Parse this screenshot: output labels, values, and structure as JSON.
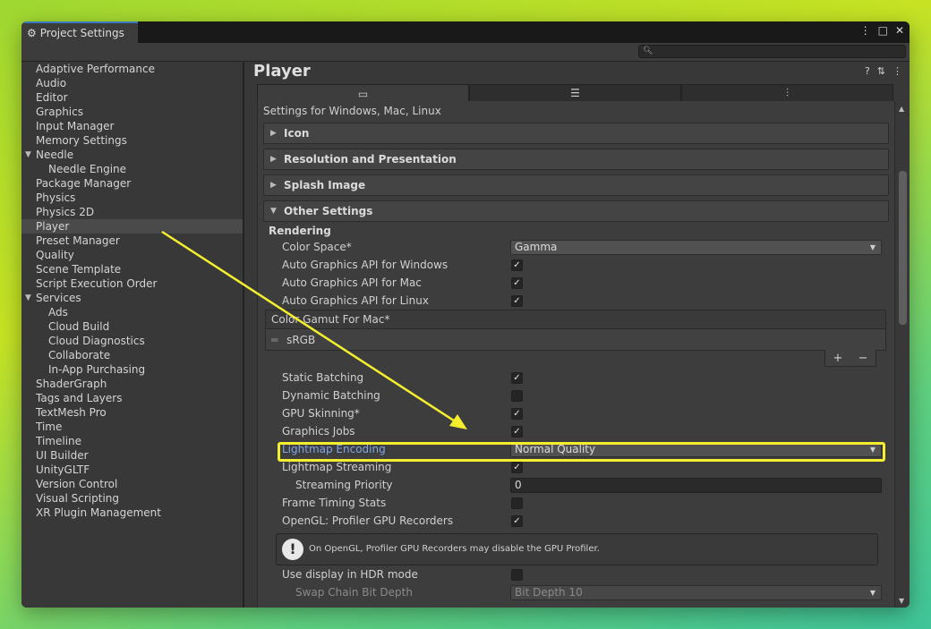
{
  "window": {
    "title": "Project Settings",
    "title_icon": "gear-icon",
    "controls": [
      "⋮",
      "□",
      "✕"
    ]
  },
  "search": {
    "placeholder": "",
    "icon": "search-icon"
  },
  "sidebar": {
    "items": [
      {
        "label": "Adaptive Performance"
      },
      {
        "label": "Audio"
      },
      {
        "label": "Editor"
      },
      {
        "label": "Graphics"
      },
      {
        "label": "Input Manager"
      },
      {
        "label": "Memory Settings"
      },
      {
        "label": "Needle"
      },
      {
        "label": "Needle Engine"
      },
      {
        "label": "Package Manager"
      },
      {
        "label": "Physics"
      },
      {
        "label": "Physics 2D"
      },
      {
        "label": "Player"
      },
      {
        "label": "Preset Manager"
      },
      {
        "label": "Quality"
      },
      {
        "label": "Scene Template"
      },
      {
        "label": "Script Execution Order"
      },
      {
        "label": "Services"
      },
      {
        "label": "Ads"
      },
      {
        "label": "Cloud Build"
      },
      {
        "label": "Cloud Diagnostics"
      },
      {
        "label": "Collaborate"
      },
      {
        "label": "In-App Purchasing"
      },
      {
        "label": "ShaderGraph"
      },
      {
        "label": "Tags and Layers"
      },
      {
        "label": "TextMesh Pro"
      },
      {
        "label": "Time"
      },
      {
        "label": "Timeline"
      },
      {
        "label": "UI Builder"
      },
      {
        "label": "UnityGLTF"
      },
      {
        "label": "Version Control"
      },
      {
        "label": "Visual Scripting"
      },
      {
        "label": "XR Plugin Management"
      }
    ]
  },
  "main": {
    "title": "Player",
    "header_icons": [
      "help-icon",
      "sliders-icon",
      "more-icon"
    ],
    "platform_tabs": [
      "monitor-icon",
      "server-icon",
      "android-icon"
    ],
    "settings_for": "Settings for Windows, Mac, Linux",
    "foldouts": [
      "Icon",
      "Resolution and Presentation",
      "Splash Image",
      "Other Settings"
    ],
    "rendering_label": "Rendering",
    "color_space": {
      "label": "Color Space*",
      "value": "Gamma"
    },
    "auto_api": [
      {
        "label": "Auto Graphics API  for Windows",
        "checked": true
      },
      {
        "label": "Auto Graphics API  for Mac",
        "checked": true
      },
      {
        "label": "Auto Graphics API  for Linux",
        "checked": true
      }
    ],
    "color_gamut": {
      "header": "Color Gamut For Mac*",
      "item": "sRGB",
      "plus": "+",
      "minus": "−"
    },
    "batching": [
      {
        "label": "Static Batching",
        "checked": true
      },
      {
        "label": "Dynamic Batching",
        "checked": false
      },
      {
        "label": "GPU Skinning*",
        "checked": true
      },
      {
        "label": "Graphics Jobs",
        "checked": true
      }
    ],
    "lightmap_encoding": {
      "label": "Lightmap Encoding",
      "value": "Normal Quality"
    },
    "lightmap_streaming": {
      "label": "Lightmap Streaming",
      "checked": true
    },
    "streaming_priority": {
      "label": "Streaming Priority",
      "value": "0"
    },
    "frame_timing": {
      "label": "Frame Timing Stats",
      "checked": false
    },
    "opengl_profiler": {
      "label": "OpenGL: Profiler GPU Recorders",
      "checked": true
    },
    "help_message": "On OpenGL, Profiler GPU Recorders may disable the GPU Profiler.",
    "hdr_display": {
      "label": "Use display in HDR mode",
      "checked": false
    },
    "swap_chain": {
      "label": "Swap Chain Bit Depth",
      "value": "Bit Depth 10"
    }
  },
  "annotation": {
    "color": "#f4ef2e"
  },
  "colors": {
    "accent": "#3a79bb",
    "link_blue": "#7fa7e8",
    "highlight": "#f4ef2e"
  }
}
